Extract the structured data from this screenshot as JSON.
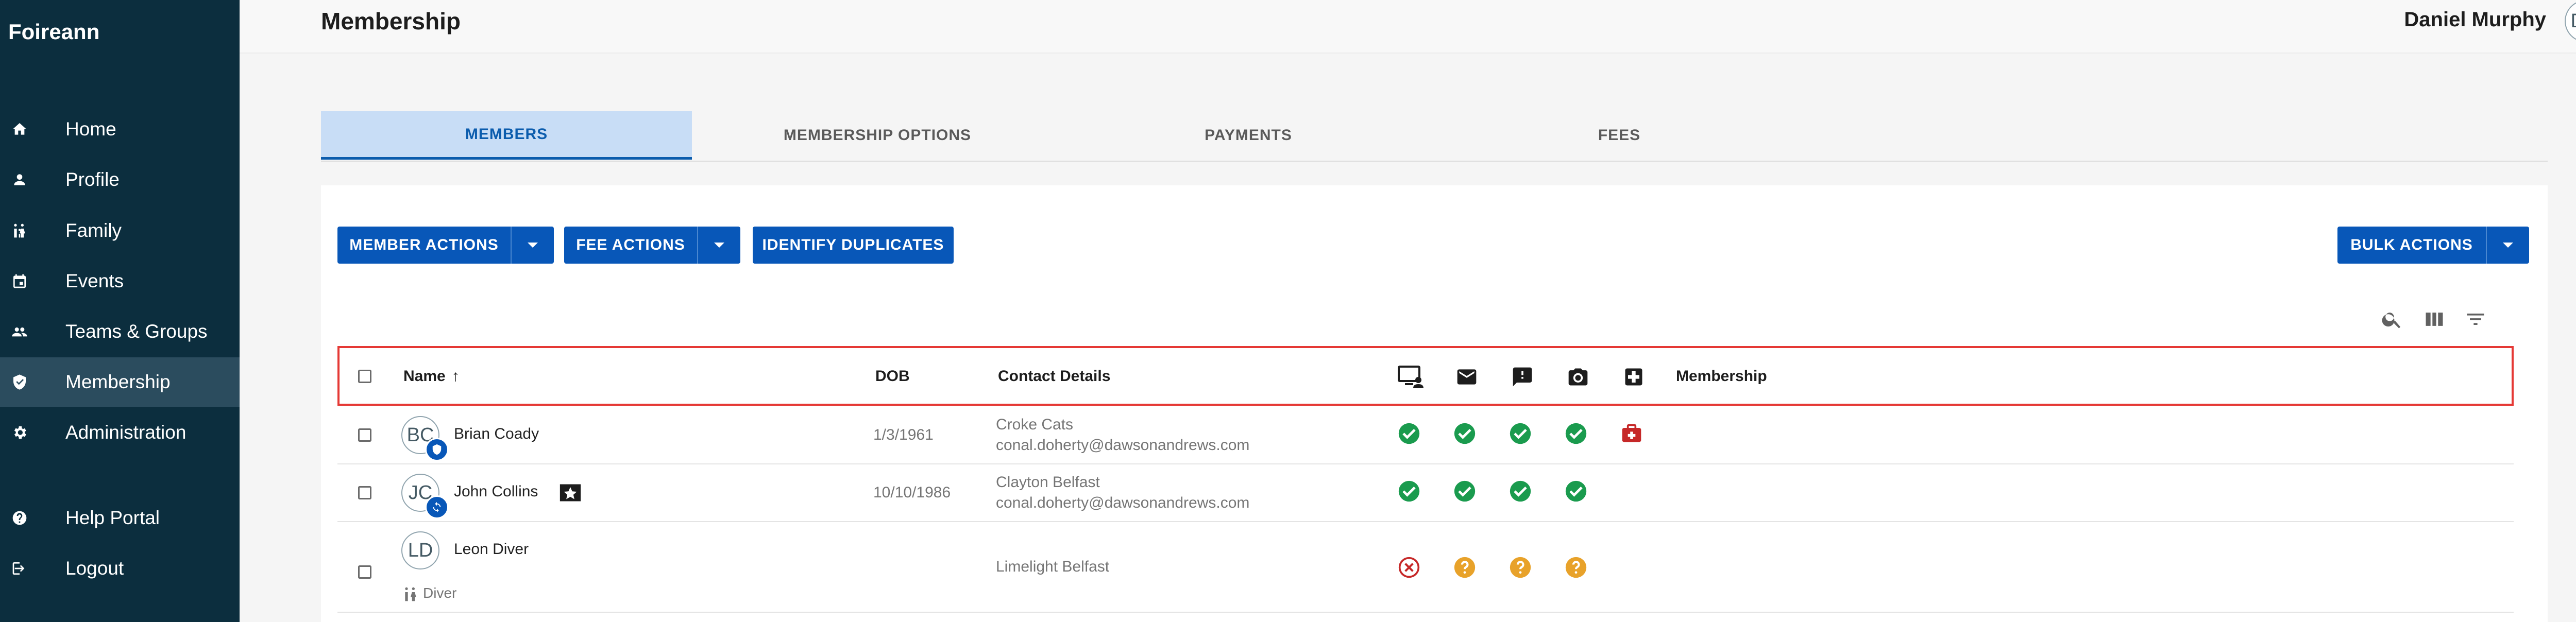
{
  "app": {
    "brand": "Foireann"
  },
  "sidebar": {
    "items": [
      {
        "label": "Home",
        "icon": "home-icon"
      },
      {
        "label": "Profile",
        "icon": "person-icon"
      },
      {
        "label": "Family",
        "icon": "family-icon"
      },
      {
        "label": "Events",
        "icon": "calendar-icon"
      },
      {
        "label": "Teams & Groups",
        "icon": "group-icon"
      },
      {
        "label": "Membership",
        "icon": "shield-icon",
        "active": true
      },
      {
        "label": "Administration",
        "icon": "gear-icon"
      },
      {
        "label": "Help Portal",
        "icon": "help-icon"
      },
      {
        "label": "Logout",
        "icon": "logout-icon"
      }
    ]
  },
  "header": {
    "title": "Membership",
    "user_name": "Daniel Murphy",
    "user_initials": "DM"
  },
  "tabs": [
    {
      "label": "MEMBERS",
      "active": true
    },
    {
      "label": "MEMBERSHIP OPTIONS"
    },
    {
      "label": "PAYMENTS"
    },
    {
      "label": "FEES"
    }
  ],
  "toolbar": {
    "member_actions": "MEMBER ACTIONS",
    "fee_actions": "FEE ACTIONS",
    "identify_duplicates": "IDENTIFY DUPLICATES",
    "bulk_actions": "BULK ACTIONS"
  },
  "table": {
    "columns": {
      "name": "Name",
      "dob": "DOB",
      "contact": "Contact Details",
      "membership": "Membership"
    },
    "sort": {
      "column": "Name",
      "direction": "ascending"
    },
    "rows": [
      {
        "initials": "BC",
        "name": "Brian Coady",
        "dob": "1/3/1961",
        "contact_line1": "Croke Cats",
        "contact_line2": "conal.doherty@dawsonandrews.com",
        "sub": ""
      },
      {
        "initials": "JC",
        "name": "John Collins",
        "dob": "10/10/1986",
        "contact_line1": "Clayton Belfast",
        "contact_line2": "conal.doherty@dawsonandrews.com",
        "sub": ""
      },
      {
        "initials": "LD",
        "name": "Leon Diver",
        "dob": "",
        "contact_line1": "Limelight Belfast",
        "contact_line2": "",
        "sub": "Diver"
      }
    ]
  },
  "colors": {
    "sidebar": "#0c2e3e",
    "primary": "#0857b8",
    "success": "#1a9b4e",
    "warning": "#e8a22a",
    "error": "#c62828"
  }
}
